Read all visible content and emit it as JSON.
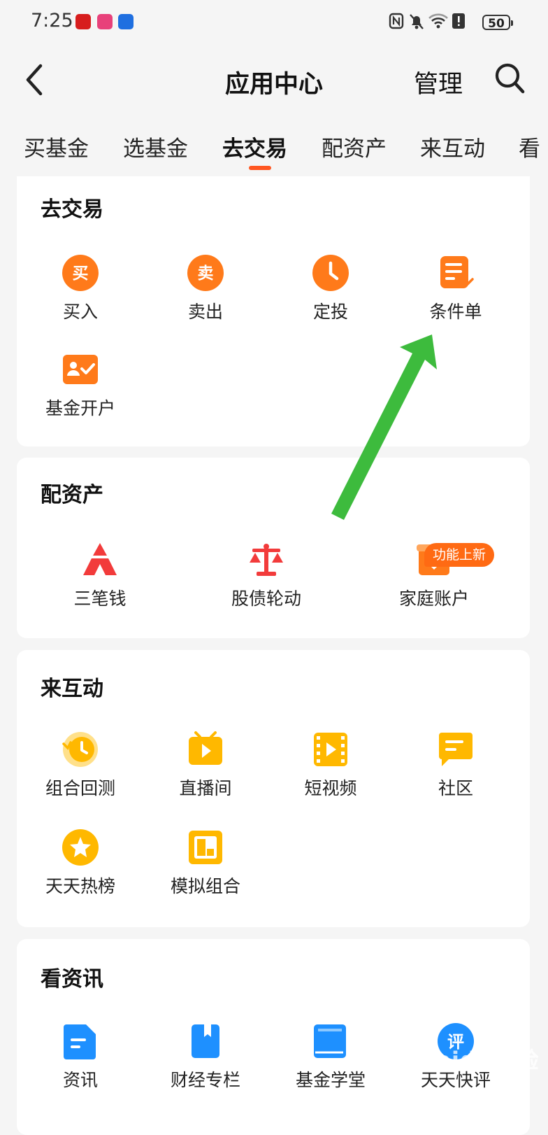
{
  "status_bar": {
    "time": "7:25",
    "battery": "50"
  },
  "header": {
    "title": "应用中心",
    "manage_label": "管理"
  },
  "tabs": [
    {
      "label": "买基金"
    },
    {
      "label": "选基金"
    },
    {
      "label": "去交易"
    },
    {
      "label": "配资产"
    },
    {
      "label": "来互动"
    },
    {
      "label": "看"
    }
  ],
  "sections": {
    "trade": {
      "title": "去交易",
      "items": [
        {
          "label": "买入",
          "icon": "buy-icon",
          "glyph": "买"
        },
        {
          "label": "卖出",
          "icon": "sell-icon",
          "glyph": "卖"
        },
        {
          "label": "定投",
          "icon": "clock-icon"
        },
        {
          "label": "条件单",
          "icon": "condition-order-icon"
        },
        {
          "label": "基金开户",
          "icon": "account-open-icon"
        }
      ]
    },
    "assets": {
      "title": "配资产",
      "badge": "功能上新",
      "items": [
        {
          "label": "三笔钱",
          "icon": "three-money-icon"
        },
        {
          "label": "股债轮动",
          "icon": "balance-scale-icon"
        },
        {
          "label": "家庭账户",
          "icon": "family-account-icon"
        }
      ]
    },
    "interact": {
      "title": "来互动",
      "items": [
        {
          "label": "组合回测",
          "icon": "backtest-icon"
        },
        {
          "label": "直播间",
          "icon": "live-room-icon"
        },
        {
          "label": "短视频",
          "icon": "short-video-icon"
        },
        {
          "label": "社区",
          "icon": "community-icon"
        },
        {
          "label": "天天热榜",
          "icon": "hot-list-icon"
        },
        {
          "label": "模拟组合",
          "icon": "simulated-portfolio-icon"
        }
      ]
    },
    "news": {
      "title": "看资讯",
      "items": [
        {
          "label": "资讯",
          "icon": "news-icon"
        },
        {
          "label": "财经专栏",
          "icon": "finance-column-icon"
        },
        {
          "label": "基金学堂",
          "icon": "fund-school-icon"
        },
        {
          "label": "天天快评",
          "icon": "quick-review-icon",
          "glyph": "评"
        }
      ]
    }
  },
  "watermark": "Baidu经验",
  "colors": {
    "accent": "#ff5722",
    "orange_icon": "#ff7a1a",
    "red_icon": "#f23b3b",
    "yellow_icon": "#ffb800",
    "blue_icon": "#1e90ff",
    "annotation_arrow": "#3dbb3d"
  }
}
